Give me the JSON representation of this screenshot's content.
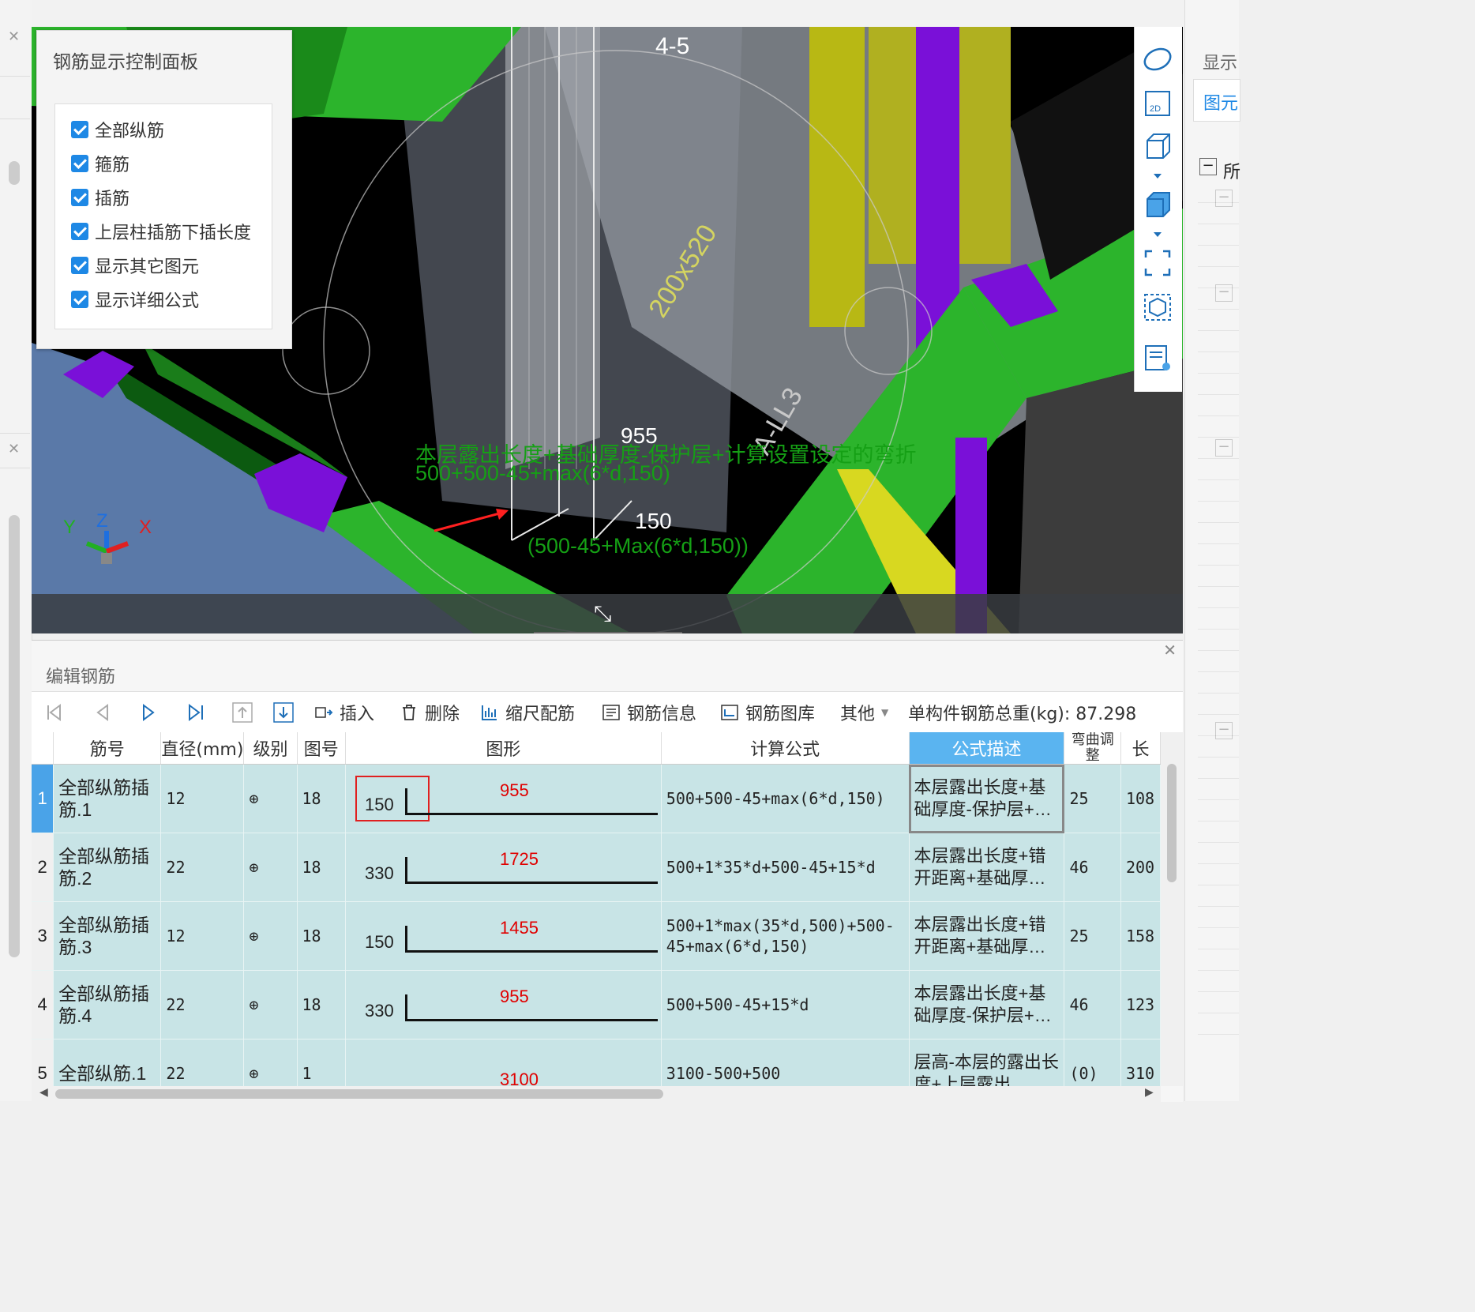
{
  "control_panel": {
    "title": "钢筋显示控制面板",
    "options": [
      {
        "label": "全部纵筋",
        "checked": true
      },
      {
        "label": "箍筋",
        "checked": true
      },
      {
        "label": "插筋",
        "checked": true
      },
      {
        "label": "上层柱插筋下插长度",
        "checked": true
      },
      {
        "label": "显示其它图元",
        "checked": true
      },
      {
        "label": "显示详细公式",
        "checked": true
      }
    ]
  },
  "viewport": {
    "axis_label_top": "4-5",
    "beam_label": "200x520",
    "beam_label2": "A-LL3",
    "dim_top": "955",
    "formula_desc": "本层露出长度+基础厚度-保护层+计算设置设定的弯折",
    "formula_expr": "500+500-45+max(6*d,150)",
    "dim_bend": "150",
    "formula_bend": "(500-45+Max(6*d,150))",
    "axis_x": "X",
    "axis_y": "Y",
    "axis_z": "Z"
  },
  "right_panel": {
    "tab1": "显示",
    "tab2": "图元",
    "tree_label": "所"
  },
  "editor": {
    "title": "编辑钢筋",
    "toolbar": {
      "insert": "插入",
      "delete": "删除",
      "scale_rebar": "缩尺配筋",
      "rebar_info": "钢筋信息",
      "rebar_lib": "钢筋图库",
      "other": "其他",
      "total_weight": "单构件钢筋总重(kg): 87.298"
    },
    "columns": [
      "筋号",
      "直径(mm)",
      "级别",
      "图号",
      "图形",
      "计算公式",
      "公式描述",
      "弯曲调整",
      "长"
    ],
    "rows": [
      {
        "num": "1",
        "name": "全部纵筋插筋.1",
        "diameter": "12",
        "grade": "⊕",
        "fig": "18",
        "bend": "150",
        "length": "955",
        "formula": "500+500-45+max(6*d,150)",
        "desc": "本层露出长度+基础厚度-保护层+…",
        "adjust": "25",
        "len": "108"
      },
      {
        "num": "2",
        "name": "全部纵筋插筋.2",
        "diameter": "22",
        "grade": "⊕",
        "fig": "18",
        "bend": "330",
        "length": "1725",
        "formula": "500+1*35*d+500-45+15*d",
        "desc": "本层露出长度+错开距离+基础厚…",
        "adjust": "46",
        "len": "200"
      },
      {
        "num": "3",
        "name": "全部纵筋插筋.3",
        "diameter": "12",
        "grade": "⊕",
        "fig": "18",
        "bend": "150",
        "length": "1455",
        "formula": "500+1*max(35*d,500)+500-45+max(6*d,150)",
        "desc": "本层露出长度+错开距离+基础厚…",
        "adjust": "25",
        "len": "158"
      },
      {
        "num": "4",
        "name": "全部纵筋插筋.4",
        "diameter": "22",
        "grade": "⊕",
        "fig": "18",
        "bend": "330",
        "length": "955",
        "formula": "500+500-45+15*d",
        "desc": "本层露出长度+基础厚度-保护层+…",
        "adjust": "46",
        "len": "123"
      },
      {
        "num": "5",
        "name": "全部纵筋.1",
        "diameter": "22",
        "grade": "⊕",
        "fig": "1",
        "bend": "",
        "length": "3100",
        "formula": "3100-500+500",
        "desc": "层高-本层的露出长度+上层露出…",
        "adjust": "(0)",
        "len": "310"
      }
    ]
  }
}
